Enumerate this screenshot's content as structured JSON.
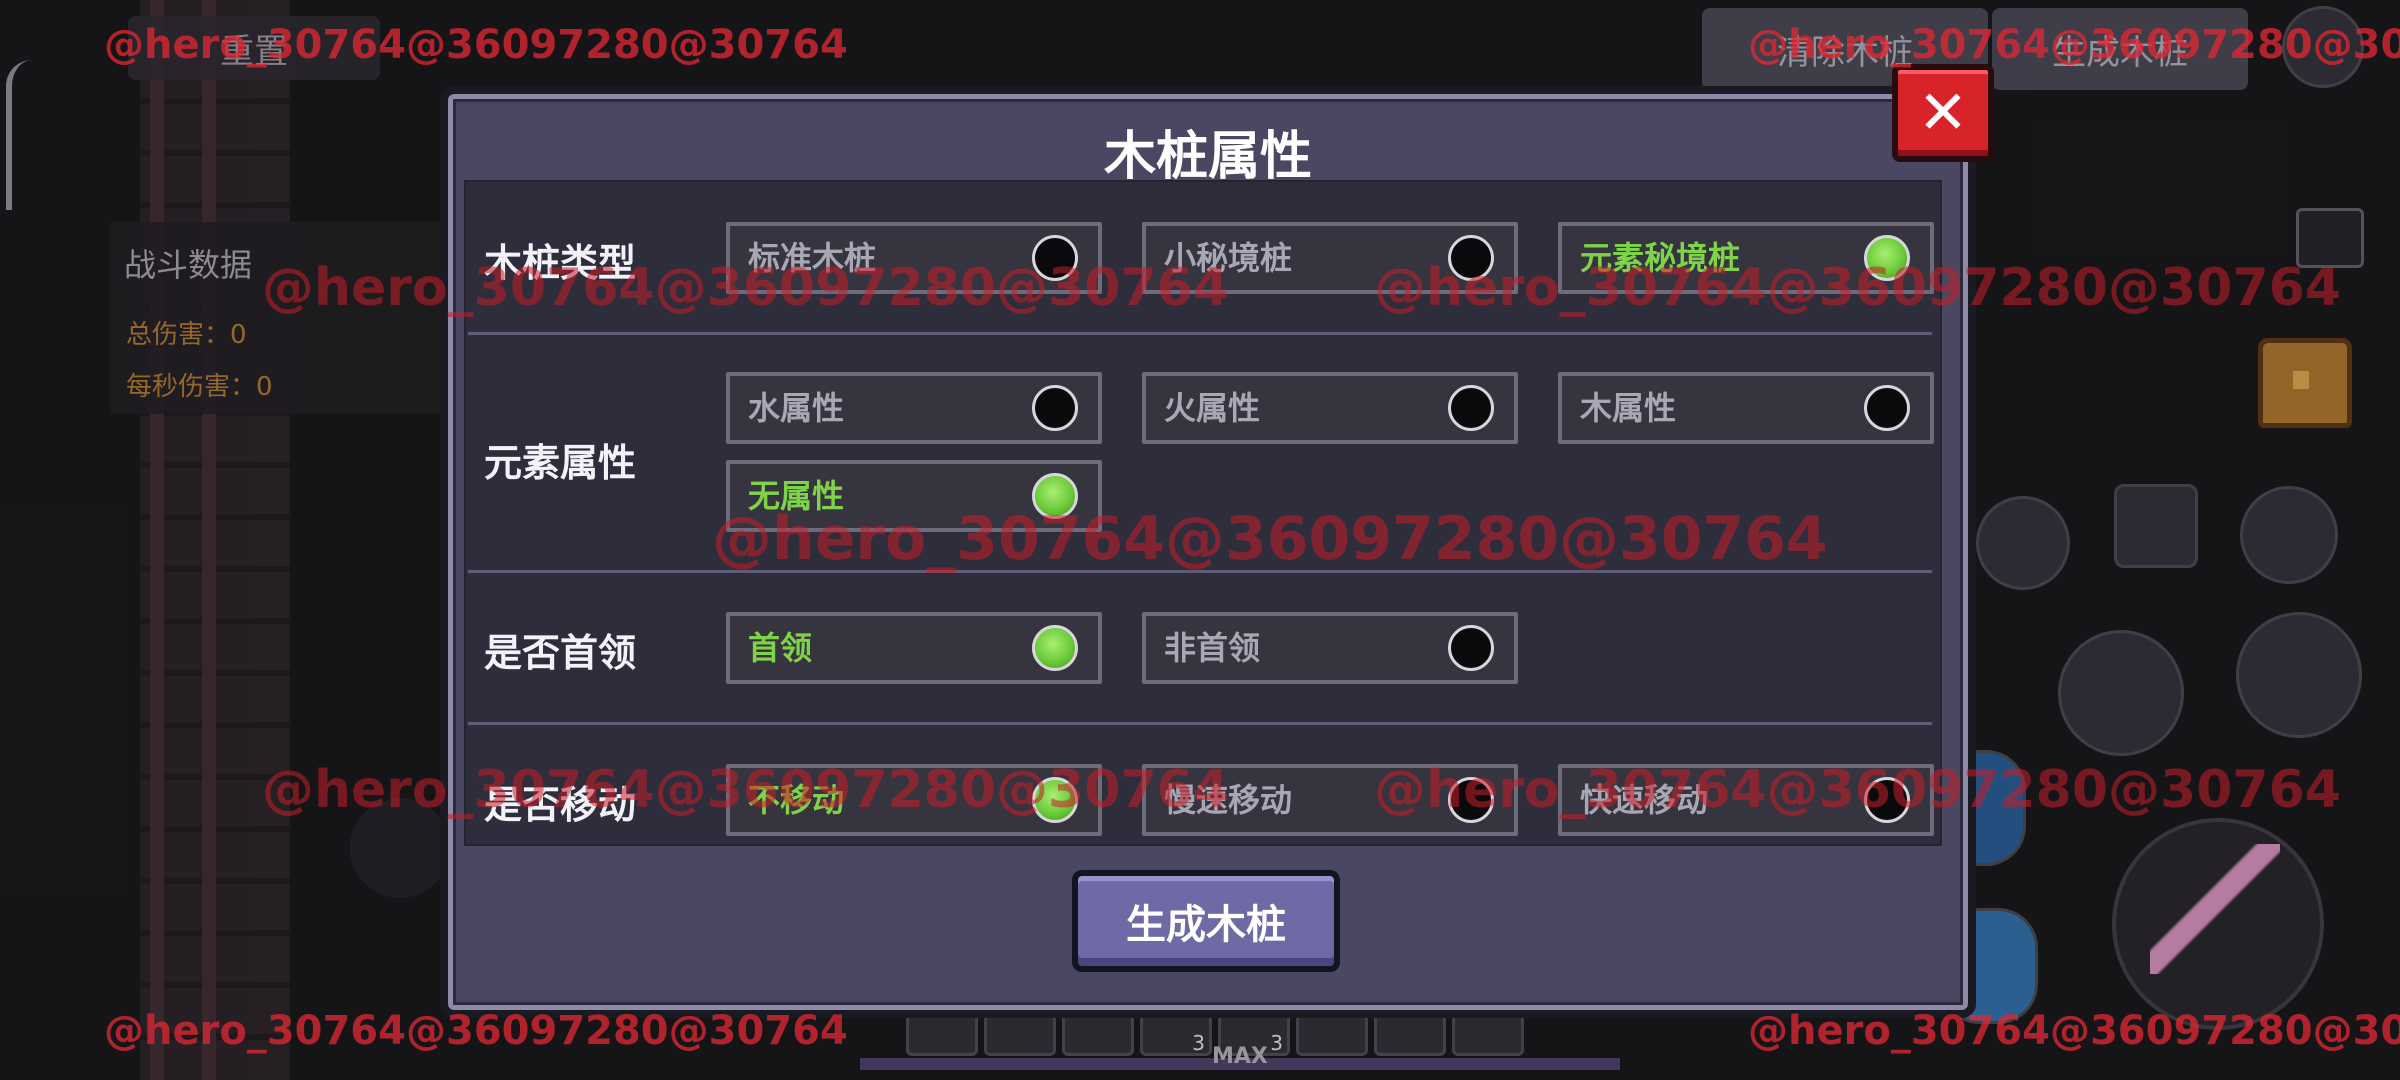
{
  "background": {
    "reset_label": "重置",
    "clear_stakes_label": "清除木桩",
    "generate_stakes_top_label": "生成木桩",
    "battle_panel": {
      "title": "战斗数据",
      "total_damage": "总伤害：0",
      "dps": "每秒伤害：0"
    },
    "xp_max_label": "MAX",
    "hotbar_counts": [
      "3",
      "3"
    ]
  },
  "modal": {
    "title": "木桩属性",
    "generate_button": "生成木桩",
    "rows": [
      {
        "label": "木桩类型",
        "options": [
          {
            "text": "标准木桩",
            "selected": false
          },
          {
            "text": "小秘境桩",
            "selected": false
          },
          {
            "text": "元素秘境桩",
            "selected": true
          }
        ]
      },
      {
        "label": "元素属性",
        "options": [
          {
            "text": "水属性",
            "selected": false
          },
          {
            "text": "火属性",
            "selected": false
          },
          {
            "text": "木属性",
            "selected": false
          },
          {
            "text": "无属性",
            "selected": true
          }
        ]
      },
      {
        "label": "是否首领",
        "options": [
          {
            "text": "首领",
            "selected": true
          },
          {
            "text": "非首领",
            "selected": false
          }
        ]
      },
      {
        "label": "是否移动",
        "options": [
          {
            "text": "不移动",
            "selected": true
          },
          {
            "text": "慢速移动",
            "selected": false
          },
          {
            "text": "快速移动",
            "selected": false
          }
        ]
      }
    ]
  },
  "watermark": "@hero_30764@36097280@30764",
  "colors": {
    "selected_text": "#7ed348",
    "close_button": "#d8232a",
    "primary_button": "#6f6aa6",
    "modal_bg": "#494761"
  }
}
